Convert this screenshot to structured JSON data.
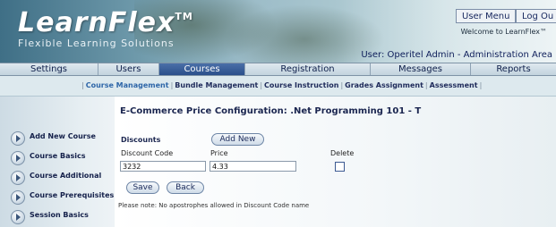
{
  "header": {
    "logo": "LearnFlex",
    "logo_mark": "TM",
    "tagline": "Flexible Learning Solutions",
    "user_menu_label": "User Menu",
    "logout_label": "Log Ou",
    "welcome_text": "Welcome to LearnFlex™",
    "user_line": "User: Operitel Admin - Administration Area"
  },
  "main_nav": [
    "Settings",
    "Users",
    "Courses",
    "Registration",
    "Messages",
    "Reports"
  ],
  "active_main_tab": "Courses",
  "sub_nav": [
    "Course Management",
    "Bundle Management",
    "Course Instruction",
    "Grades Assignment",
    "Assessment"
  ],
  "active_sub_tab": "Course Management",
  "sidebar": {
    "items": [
      {
        "label": "Add New Course"
      },
      {
        "label": "Course Basics"
      },
      {
        "label": "Course Additional"
      },
      {
        "label": "Course Prerequisites"
      },
      {
        "label": "Session Basics"
      }
    ]
  },
  "form": {
    "title": "E-Commerce Price Configuration: .Net Programming 101 - T",
    "discounts_label": "Discounts",
    "add_new_label": "Add New",
    "col_discount_code": "Discount Code",
    "col_price": "Price",
    "col_delete": "Delete",
    "discount_code_value": "3232",
    "price_value": "4.33",
    "delete_checked": false,
    "save_label": "Save",
    "back_label": "Back",
    "note": "Please note: No apostrophes allowed in Discount Code name"
  }
}
